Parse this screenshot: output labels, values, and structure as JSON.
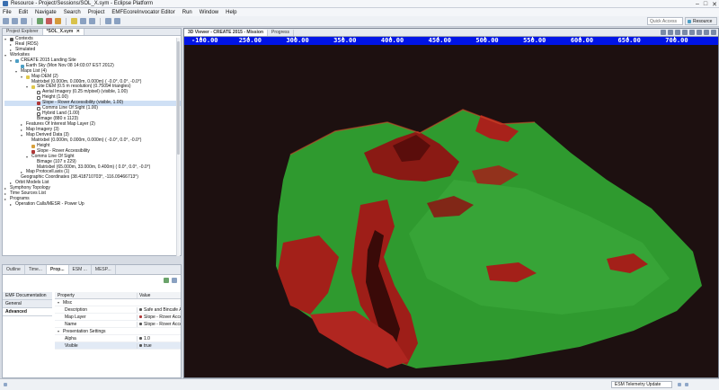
{
  "window": {
    "title": "Resource - Project/Sessions/SOL_X.sym - Eclipse Platform",
    "controls": [
      "–",
      "□",
      "✕"
    ]
  },
  "menu": [
    "File",
    "Edit",
    "Navigate",
    "Search",
    "Project",
    "EMFEcoreInvocator Editor",
    "Run",
    "Window",
    "Help"
  ],
  "toolbar": {
    "quick_access_placeholder": "Quick Access",
    "perspective_label": "Resource"
  },
  "left_tabs": [
    {
      "label": "Project Explorer",
      "active": false
    },
    {
      "label": "*SOL_X.sym",
      "active": true,
      "close": "✕"
    }
  ],
  "tree": [
    {
      "label": "Contexts",
      "indent": 0,
      "tw": "▾",
      "icon": "k"
    },
    {
      "label": "Real (RDS)",
      "indent": 1,
      "tw": "▸",
      "icon": ""
    },
    {
      "label": "Simulated",
      "indent": 1,
      "tw": "▸",
      "icon": ""
    },
    {
      "label": "Worksites",
      "indent": 0,
      "tw": "▾",
      "icon": ""
    },
    {
      "label": "CREATE 2015 Landing Site",
      "indent": 1,
      "tw": "▾",
      "icon": "c"
    },
    {
      "label": "Earth Sky (Mon Nov 08 14:03:07 EST 2012)",
      "indent": 2,
      "tw": "",
      "icon": "c"
    },
    {
      "label": "Maps List (4)",
      "indent": 2,
      "tw": "▾",
      "icon": ""
    },
    {
      "label": "Map DEM (2)",
      "indent": 3,
      "tw": "▾",
      "icon": "y"
    },
    {
      "label": "Matrixbel (0.000m, 0.000m, 0.000m) ( -0.0°, 0.0°, -0.0°)",
      "indent": 4,
      "tw": "",
      "icon": ""
    },
    {
      "label": "Site DEM (0.5 m resolution) (0.75094 triangles)",
      "indent": 4,
      "tw": "▾",
      "icon": "y"
    },
    {
      "label": "Aerial Imagery (0.25 m/pixel) (visible, 1.00)",
      "indent": 5,
      "tw": "",
      "icon": "cb"
    },
    {
      "label": "Height (1.00)",
      "indent": 5,
      "tw": "",
      "icon": "cb"
    },
    {
      "label": "Slope - Rover Accessibility (visible, 1.00)",
      "indent": 5,
      "tw": "",
      "icon": "r",
      "selected": true
    },
    {
      "label": "Comms Line Of Sight (1.00)",
      "indent": 5,
      "tw": "",
      "icon": "cb"
    },
    {
      "label": "Hybrid Land (1.00)",
      "indent": 5,
      "tw": "",
      "icon": "cb"
    },
    {
      "label": "Bimage (880 x 1123)",
      "indent": 5,
      "tw": "",
      "icon": ""
    },
    {
      "label": "Features Of Interest Map Layer (2)",
      "indent": 3,
      "tw": "▸",
      "icon": ""
    },
    {
      "label": "Map Imagery (3)",
      "indent": 3,
      "tw": "▸",
      "icon": ""
    },
    {
      "label": "Map Derived Data (3)",
      "indent": 3,
      "tw": "▾",
      "icon": ""
    },
    {
      "label": "Matrixbel (0.000m, 0.000m, 0.000m) ( -0.0°, 0.0°, -0.0°)",
      "indent": 4,
      "tw": "",
      "icon": ""
    },
    {
      "label": "Height",
      "indent": 4,
      "tw": "",
      "icon": "o"
    },
    {
      "label": "Slope - Rover Accessibility",
      "indent": 4,
      "tw": "",
      "icon": "r"
    },
    {
      "label": "Comms Line Of Sight",
      "indent": 4,
      "tw": "▾",
      "icon": ""
    },
    {
      "label": "Bimage (107 x 229)",
      "indent": 5,
      "tw": "",
      "icon": ""
    },
    {
      "label": "Matrixbel (65.000m, 33.000m, 0.400m) ( 0.0°, 0.0°, -0.0°)",
      "indent": 5,
      "tw": "",
      "icon": ""
    },
    {
      "label": "Map Protocell.axis (1)",
      "indent": 3,
      "tw": "▸",
      "icon": ""
    },
    {
      "label": "Geographic Coordinates (38.418710703°, -116.09466713°)",
      "indent": 2,
      "tw": "",
      "icon": ""
    },
    {
      "label": "Orbit Models List",
      "indent": 1,
      "tw": "▸",
      "icon": ""
    },
    {
      "label": "Symphony Topology",
      "indent": 0,
      "tw": "▸",
      "icon": ""
    },
    {
      "label": "Time Sources List",
      "indent": 0,
      "tw": "▸",
      "icon": ""
    },
    {
      "label": "Programs",
      "indent": 0,
      "tw": "▸",
      "icon": ""
    },
    {
      "label": "Operation Calls/MESR - Power Up",
      "indent": 1,
      "tw": "▸",
      "icon": ""
    }
  ],
  "bottom_tabs": [
    {
      "label": "Outline",
      "active": false
    },
    {
      "label": "Time...",
      "active": false
    },
    {
      "label": "Prop...",
      "active": true
    },
    {
      "label": "ESM ...",
      "active": false
    },
    {
      "label": "MESP...",
      "active": false
    }
  ],
  "props": {
    "side_tabs": [
      {
        "label": "EMF Documentation",
        "active": false
      },
      {
        "label": "General",
        "active": false
      },
      {
        "label": "Advanced",
        "active": true
      }
    ],
    "headers": {
      "property": "Property",
      "value": "Value"
    },
    "rows": [
      {
        "key": "Misc",
        "value": "",
        "group": true,
        "indent": 0
      },
      {
        "key": "Description",
        "value": "Safe and Bincafe Are",
        "indent": 1
      },
      {
        "key": "Map Layer",
        "value": "Slope - Rover Acces",
        "indent": 1
      },
      {
        "key": "Name",
        "value": "Slope - Rover Acces",
        "indent": 1
      },
      {
        "key": "Presentation Settings",
        "value": "",
        "group": true,
        "indent": 0
      },
      {
        "key": "Alpha",
        "value": "1.0",
        "indent": 1
      },
      {
        "key": "Visible",
        "value": "true",
        "indent": 1,
        "highlight": true
      }
    ]
  },
  "viewer": {
    "tabs": [
      {
        "label": "3D Viewer - CREATE 2015 - Mission",
        "active": true
      },
      {
        "label": "Progress",
        "active": false
      }
    ],
    "ruler_labels": [
      "-100.00",
      "250.00",
      "300.00",
      "350.00",
      "400.00",
      "450.00",
      "500.00",
      "550.00",
      "600.00",
      "650.00",
      "700.00"
    ]
  },
  "status": {
    "right_text": "ESM Telemetry Update"
  }
}
